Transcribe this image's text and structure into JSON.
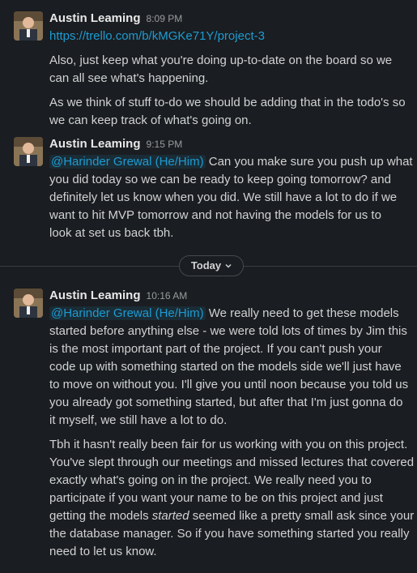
{
  "messages": [
    {
      "author": "Austin Leaming",
      "time": "8:09 PM",
      "link": "https://trello.com/b/kMGKe71Y/project-3",
      "p1": [
        "Also, just keep what you're doing up-to-date on the board so we",
        "can all see what's happening."
      ],
      "p2": [
        "As we think of stuff to-do we should be adding that in the todo's so",
        "we can keep track of what's going on."
      ]
    },
    {
      "author": "Austin Leaming",
      "time": "9:15 PM",
      "mention": "@Harinder Grewal (He/Him)",
      "first_line_rest": " Can you make sure you push up what",
      "lines": [
        "you did today so we can be ready to keep going tomorrow? and",
        "definitely let us know when you did. We still have a lot to do if we",
        "want to hit MVP tomorrow and not having the models for us to",
        "look at set us back tbh."
      ]
    },
    {
      "author": "Austin Leaming",
      "time": "10:16 AM",
      "mention": "@Harinder Grewal (He/Him)",
      "first_line_rest": " We really need to get these models",
      "lines": [
        "started before anything else - we were told lots of times by Jim this",
        "is the most important part of the project. If you can't push your",
        "code up with something started on the models side we'll just have",
        "to move on without you. I'll give you until noon because you told us",
        "you already got something started, but after that I'm just gonna do",
        "it myself, we still have a lot to do."
      ],
      "p2": [
        "Tbh it hasn't really been fair for us working with you on this project.",
        "You've slept through our meetings and missed lectures that covered",
        "exactly what's going on in the project. We really need you to",
        "participate if you want your name to be on this project and just"
      ],
      "p2_italic_pre": "getting the models ",
      "p2_italic": "started",
      "p2_italic_post": " seemed like a pretty small ask since your",
      "p2_tail": [
        "the database manager. So if you have something started you really",
        "need to let us know."
      ]
    }
  ],
  "divider_label": "Today",
  "icons": {
    "avatar": "user-avatar-photo",
    "chevron": "chevron-down-icon"
  }
}
